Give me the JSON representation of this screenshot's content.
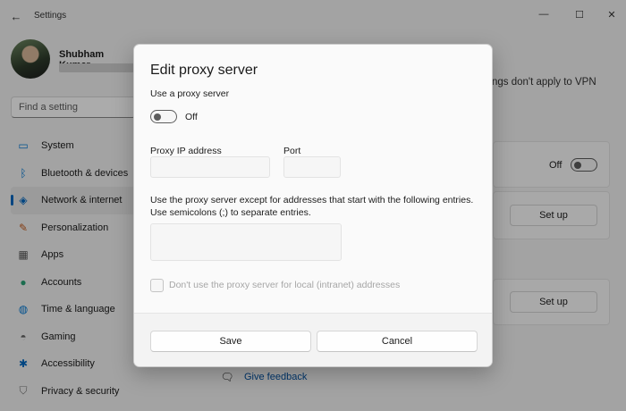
{
  "window": {
    "title": "Settings",
    "back_icon": "←",
    "minimize_icon": "—",
    "maximize_icon": "☐",
    "close_icon": "✕"
  },
  "profile": {
    "name": "Shubham Kumar"
  },
  "search": {
    "placeholder": "Find a setting"
  },
  "sidebar": {
    "items": [
      {
        "label": "System",
        "icon": "monitor-icon",
        "glyph": "▭",
        "color": "#0078d4"
      },
      {
        "label": "Bluetooth & devices",
        "icon": "bluetooth-icon",
        "glyph": "ᛒ",
        "color": "#0078d4"
      },
      {
        "label": "Network & internet",
        "icon": "wifi-icon",
        "glyph": "◈",
        "color": "#0067c0"
      },
      {
        "label": "Personalization",
        "icon": "brush-icon",
        "glyph": "✎",
        "color": "#c45a1c"
      },
      {
        "label": "Apps",
        "icon": "apps-icon",
        "glyph": "▦",
        "color": "#555555"
      },
      {
        "label": "Accounts",
        "icon": "person-icon",
        "glyph": "●",
        "color": "#2aa377"
      },
      {
        "label": "Time & language",
        "icon": "globe-icon",
        "glyph": "◍",
        "color": "#0078d4"
      },
      {
        "label": "Gaming",
        "icon": "gamepad-icon",
        "glyph": "◓",
        "color": "#666666"
      },
      {
        "label": "Accessibility",
        "icon": "accessibility-icon",
        "glyph": "✱",
        "color": "#0067c0"
      },
      {
        "label": "Privacy & security",
        "icon": "shield-icon",
        "glyph": "⛉",
        "color": "#777777"
      }
    ],
    "active_index": 2
  },
  "background": {
    "vpn_note": "ngs don't apply to VPN",
    "auto_detect_toggle_label": "Off",
    "setup_button_1": "Set up",
    "setup_button_2": "Set up",
    "feedback_label": "Give feedback",
    "feedback_icon": "feedback-icon"
  },
  "dialog": {
    "title": "Edit proxy server",
    "use_proxy_label": "Use a proxy server",
    "use_proxy_state": "Off",
    "proxy_ip_label": "Proxy IP address",
    "proxy_ip_value": "",
    "port_label": "Port",
    "port_value": "",
    "exceptions_line1": "Use the proxy server except for addresses that start with the following entries.",
    "exceptions_line2": "Use semicolons (;) to separate entries.",
    "exceptions_value": "",
    "local_checkbox_label": "Don't use the proxy server for local (intranet) addresses",
    "save_label": "Save",
    "cancel_label": "Cancel"
  },
  "colors": {
    "accent": "#0067c0",
    "overlay": "rgba(0,0,0,0.33)"
  }
}
